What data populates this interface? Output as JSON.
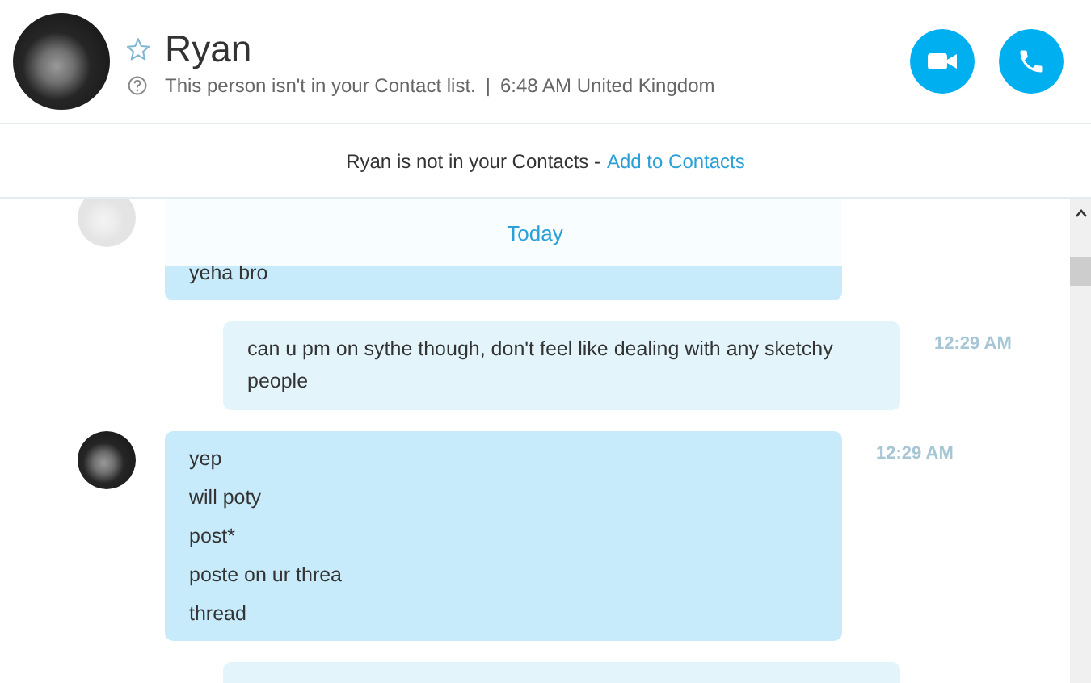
{
  "header": {
    "name": "Ryan",
    "favorite": false,
    "status_text": "This person isn't in your Contact list.",
    "separator": "|",
    "local_time": "6:48 AM United Kingdom"
  },
  "notice": {
    "text": "Ryan is not in your Contacts -",
    "link": "Add to Contacts"
  },
  "date_label": "Today",
  "messages": [
    {
      "kind": "incoming",
      "lines": [
        "yeha bro"
      ]
    },
    {
      "kind": "outgoing",
      "time": "12:29 AM",
      "lines": [
        "can u pm on sythe though, don't feel like dealing with any sketchy people"
      ]
    },
    {
      "kind": "incoming",
      "time": "12:29 AM",
      "lines": [
        "yep",
        "will poty",
        "post*",
        "poste on ur threa",
        "thread"
      ]
    },
    {
      "kind": "outgoing"
    }
  ]
}
